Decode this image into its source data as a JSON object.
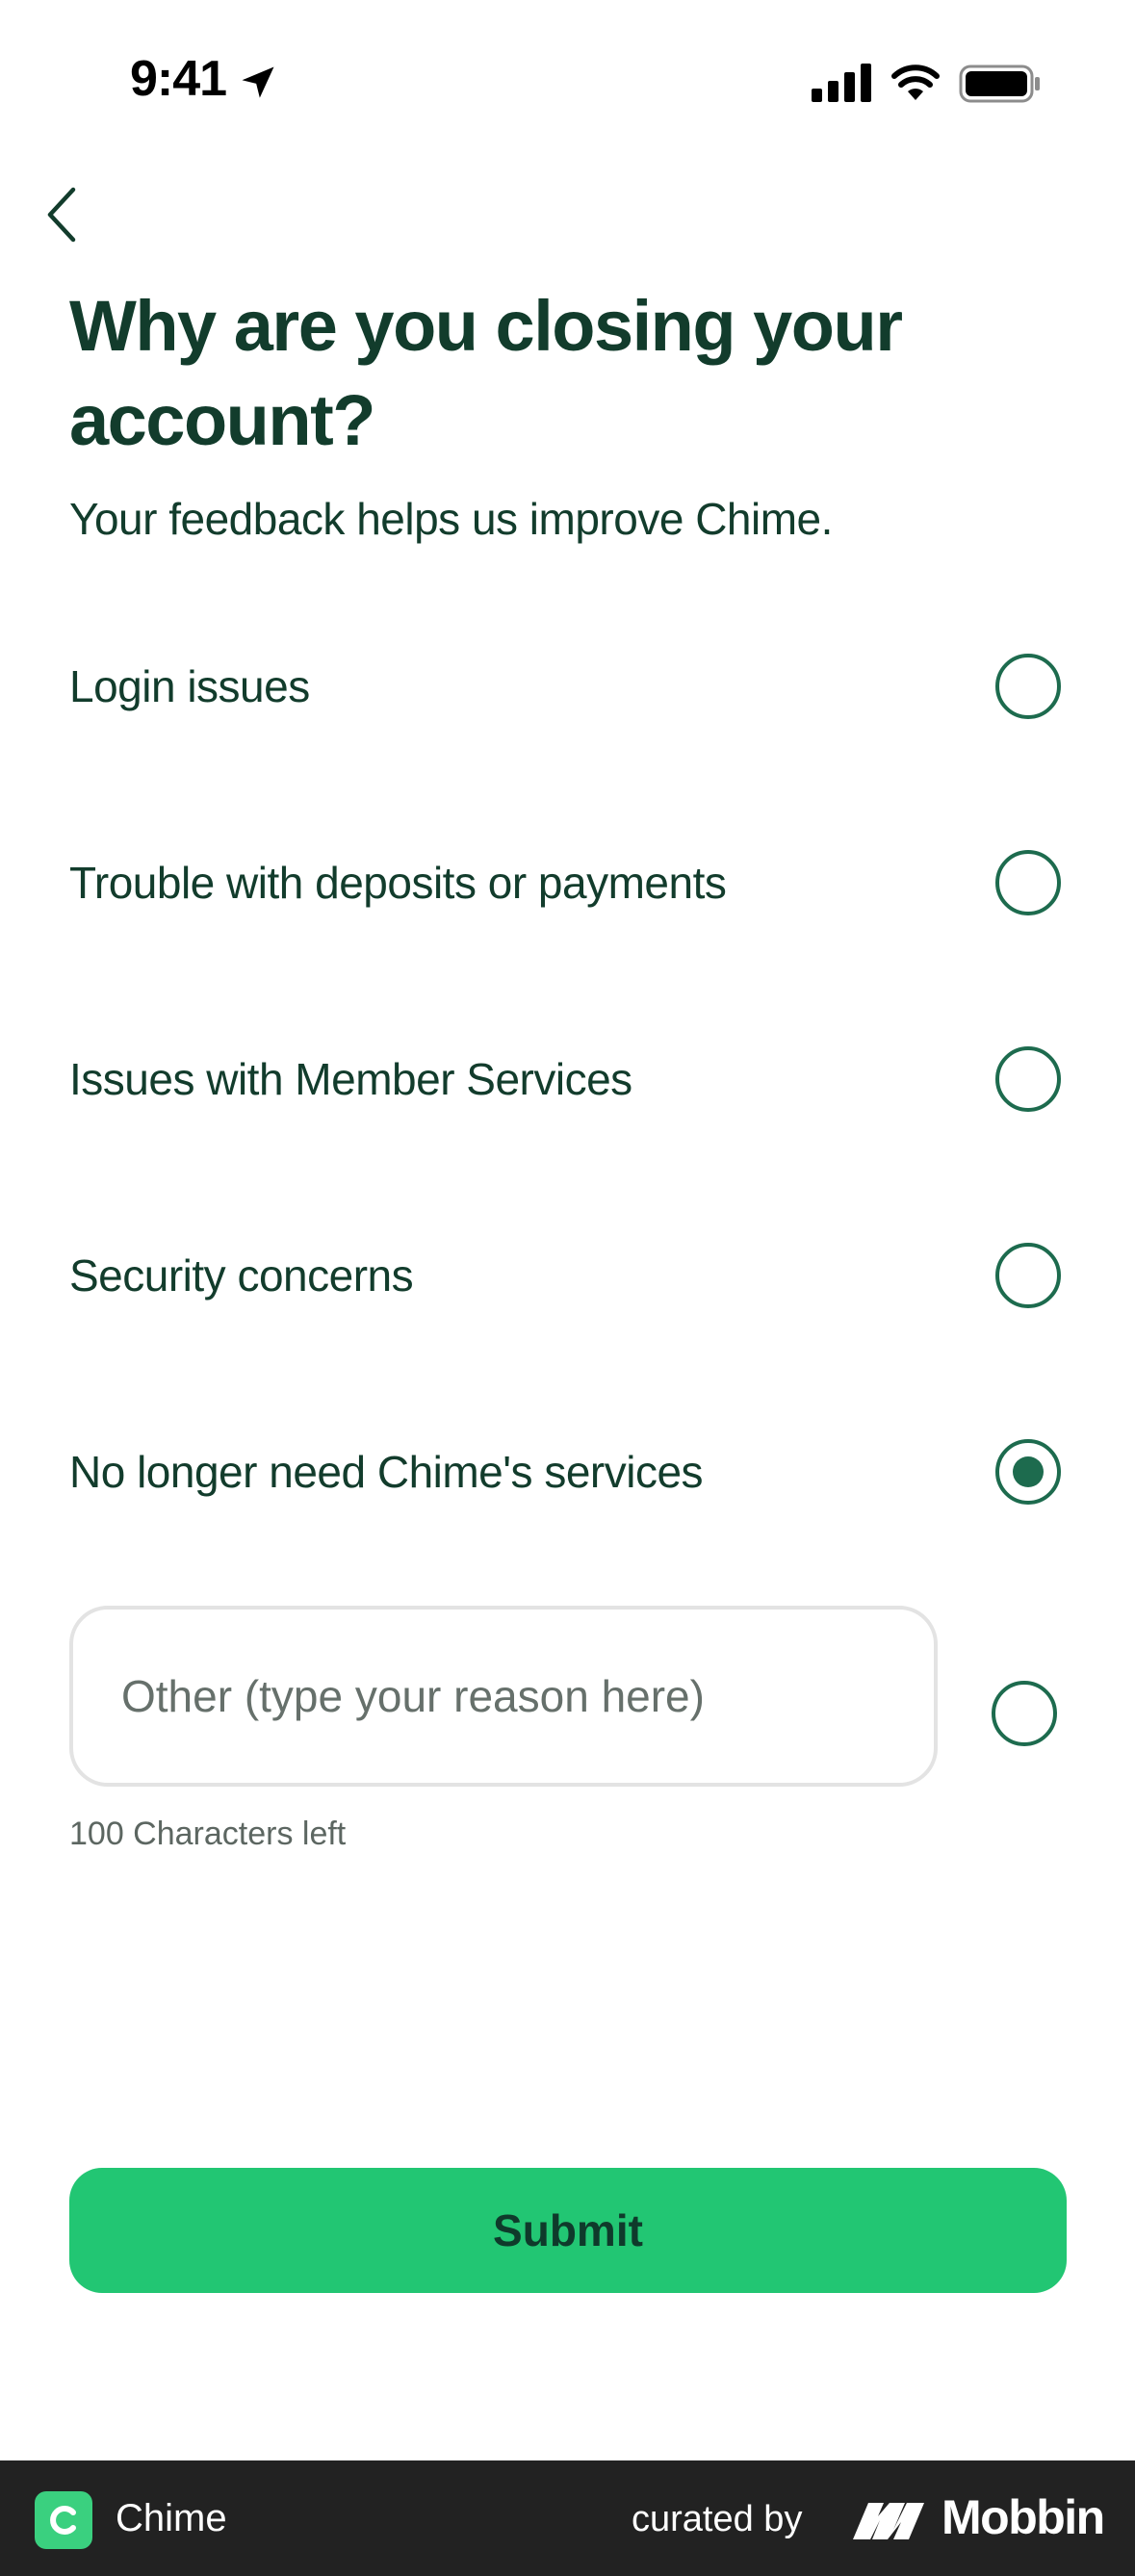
{
  "status_bar": {
    "time": "9:41",
    "icons": [
      "location-arrow-icon",
      "cellular-signal-icon",
      "wifi-icon",
      "battery-icon"
    ]
  },
  "nav": {
    "back_icon": "chevron-left-icon"
  },
  "header": {
    "title": "Why are you closing your account?",
    "subtitle": "Your feedback helps us improve Chime."
  },
  "reasons": {
    "options": [
      {
        "label": "Login issues",
        "selected": false
      },
      {
        "label": "Trouble with deposits or payments",
        "selected": false
      },
      {
        "label": "Issues with Member Services",
        "selected": false
      },
      {
        "label": "Security concerns",
        "selected": false
      },
      {
        "label": "No longer need Chime's services",
        "selected": true
      }
    ],
    "other": {
      "value": "",
      "placeholder": "Other (type your reason here)",
      "selected": false,
      "char_count": "100 Characters left"
    }
  },
  "submit": {
    "label": "Submit"
  },
  "footer": {
    "app_logo_letter": "C",
    "app_name": "Chime",
    "curated_by": "curated by",
    "brand": "Mobbin"
  },
  "colors": {
    "text": "#123c2c",
    "radio": "#1d6b4e",
    "accent": "#22c673",
    "input_border": "#e3e3e3",
    "footer_bg": "#222222",
    "app_logo_bg": "#3ad07f"
  }
}
